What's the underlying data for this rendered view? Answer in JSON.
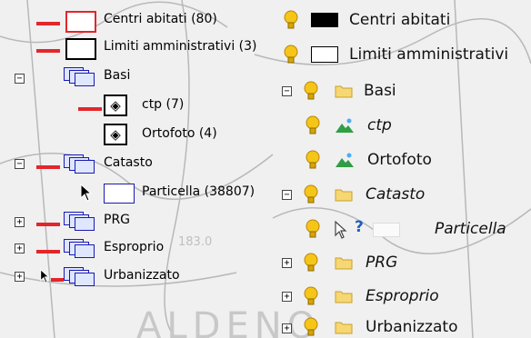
{
  "map": {
    "labels": [
      "ALDENO",
      "183.0"
    ]
  },
  "left_tree": [
    {
      "label": "Centri abitati (80)",
      "symbol": "polygon-red-outline"
    },
    {
      "label": "Limiti amministrativi (3)",
      "symbol": "polygon-black-outline"
    },
    {
      "label": "Basi",
      "symbol": "layer-group-icon",
      "toggle": "−"
    },
    {
      "label": "ctp (7)",
      "symbol": "raster-point-icon"
    },
    {
      "label": "Ortofoto (4)",
      "symbol": "raster-point-icon"
    },
    {
      "label": "Catasto",
      "symbol": "layer-group-icon",
      "toggle": "−"
    },
    {
      "label": "Particella (38807)",
      "symbol": "polygon-blue-outline"
    },
    {
      "label": "PRG",
      "symbol": "layer-group-icon",
      "toggle": "+"
    },
    {
      "label": "Esproprio",
      "symbol": "layer-group-icon",
      "toggle": "+"
    },
    {
      "label": "Urbanizzato",
      "symbol": "layer-group-icon",
      "toggle": "+"
    }
  ],
  "right_tree": [
    {
      "label": "Centri abitati",
      "icon": "bulb-icon",
      "symbol": "black-swatch"
    },
    {
      "label": "Limiti amministrativi",
      "icon": "bulb-icon",
      "symbol": "white-swatch"
    },
    {
      "label": "Basi",
      "icon": "folder-icon",
      "toggle": "−"
    },
    {
      "label": "ctp",
      "icon": "image-icon",
      "italic": true
    },
    {
      "label": "Ortofoto",
      "icon": "image-icon"
    },
    {
      "label": "Catasto",
      "icon": "folder-icon",
      "toggle": "−",
      "italic": true
    },
    {
      "label": "Particella",
      "icon": "query-icon",
      "italic": true
    },
    {
      "label": "PRG",
      "icon": "folder-icon",
      "toggle": "+",
      "italic": true
    },
    {
      "label": "Esproprio",
      "icon": "folder-icon",
      "toggle": "+",
      "italic": true
    },
    {
      "label": "Urbanizzato",
      "icon": "folder-icon",
      "toggle": "+"
    }
  ],
  "colors": {
    "accent_red": "#e3262b",
    "particella_blue": "#1a1ab0",
    "bulb_yellow": "#f5c518"
  }
}
